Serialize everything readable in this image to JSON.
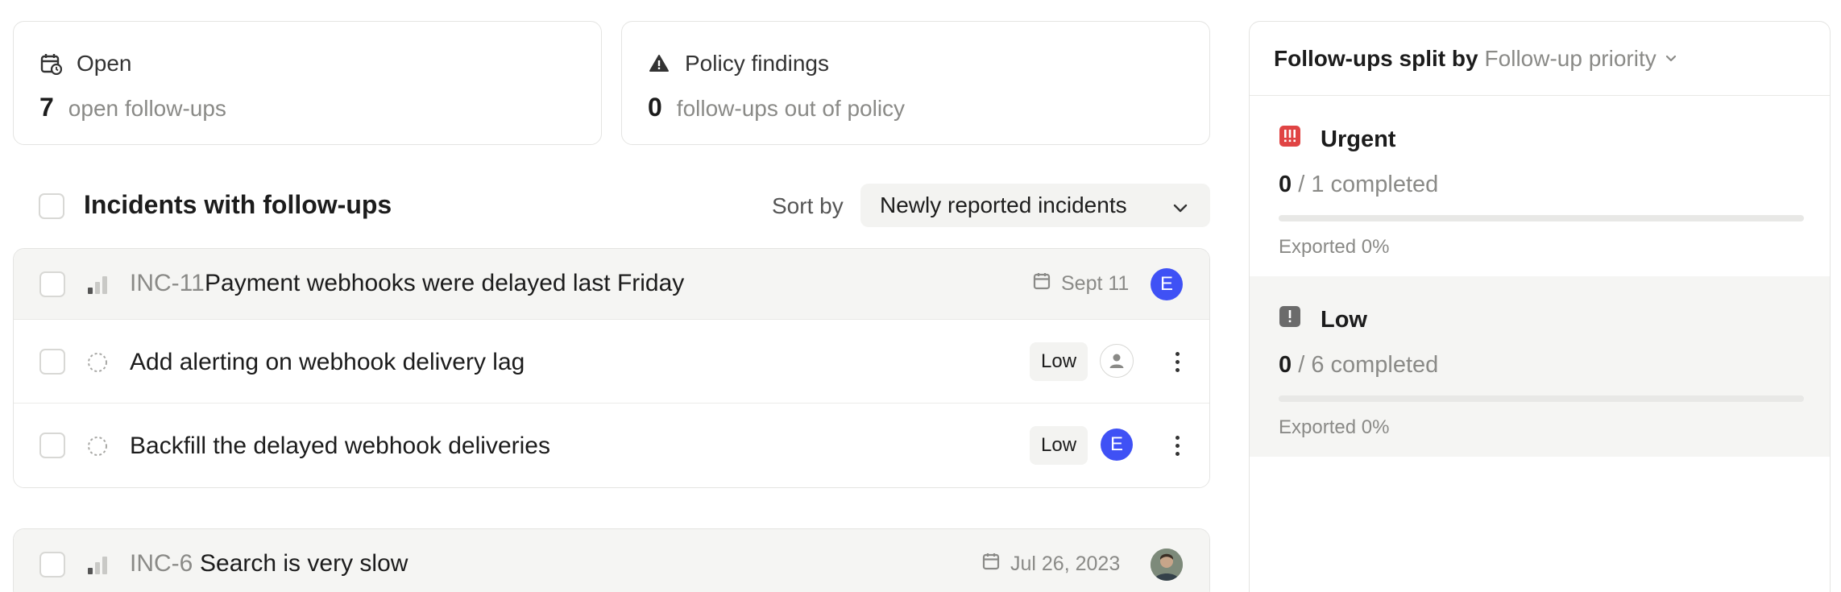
{
  "stats": {
    "open": {
      "label": "Open",
      "count": "7",
      "text": "open follow-ups",
      "icon": "calendar-clock-icon"
    },
    "policy": {
      "label": "Policy findings",
      "count": "0",
      "text": "follow-ups out of policy",
      "icon": "warning-icon"
    }
  },
  "list": {
    "title": "Incidents with follow-ups",
    "sort_label": "Sort by",
    "sort_value": "Newly reported incidents"
  },
  "incidents": [
    {
      "id": "INC-11",
      "title": "Payment webhooks were delayed last Friday",
      "date": "Sept 11",
      "avatar": "E",
      "followups": [
        {
          "title": "Add alerting on webhook delivery lag",
          "priority": "Low",
          "assignee": ""
        },
        {
          "title": "Backfill the delayed webhook deliveries",
          "priority": "Low",
          "assignee": "E"
        }
      ]
    },
    {
      "id": "INC-6",
      "title": "Search is very slow",
      "date": "Jul 26, 2023"
    }
  ],
  "panel": {
    "title": "Follow-ups split by",
    "group_by": "Follow-up priority",
    "priorities": [
      {
        "name": "Urgent",
        "completed": "0",
        "total_text": "/ 1 completed",
        "progress": 0,
        "exported": "Exported 0%",
        "icon_color": "#e04444"
      },
      {
        "name": "Low",
        "completed": "0",
        "total_text": "/ 6 completed",
        "progress": 0,
        "exported": "Exported 0%",
        "icon_color": "#6b6b6b"
      }
    ]
  },
  "colors": {
    "accent": "#3f51f5",
    "urgent": "#e04444"
  }
}
